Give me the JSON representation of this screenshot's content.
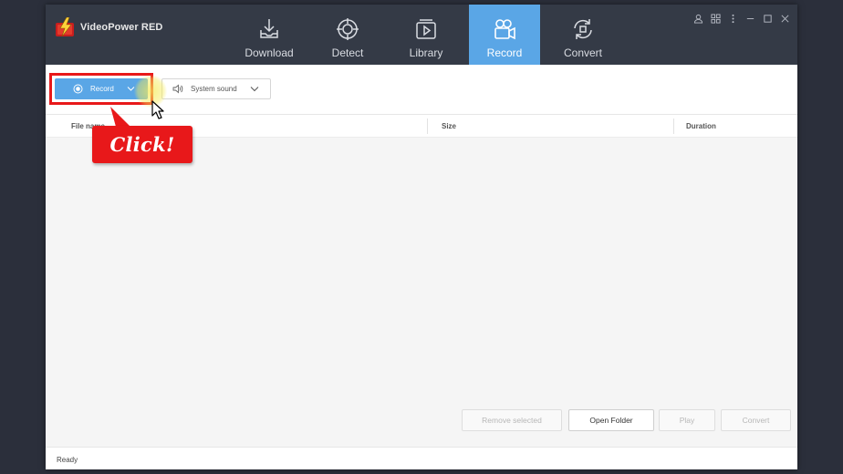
{
  "app": {
    "title": "VideoPower RED"
  },
  "tabs": [
    {
      "label": "Download",
      "icon": "download-icon"
    },
    {
      "label": "Detect",
      "icon": "detect-icon"
    },
    {
      "label": "Library",
      "icon": "library-icon"
    },
    {
      "label": "Record",
      "icon": "record-camera-icon",
      "active": true
    },
    {
      "label": "Convert",
      "icon": "convert-icon"
    }
  ],
  "window_controls": [
    "user-icon",
    "grid-icon",
    "more-icon",
    "minimize-icon",
    "maximize-icon",
    "close-icon"
  ],
  "toolbar": {
    "record_label": "Record",
    "sound_label": "System sound"
  },
  "table": {
    "columns": [
      "File name",
      "Size",
      "Duration"
    ],
    "rows": []
  },
  "actions": {
    "remove_selected": "Remove selected",
    "open_folder": "Open Folder",
    "play": "Play",
    "convert": "Convert"
  },
  "status": {
    "text": "Ready"
  },
  "annotation": {
    "callout_text": "Click!"
  },
  "colors": {
    "titlebar": "#343a46",
    "accent": "#5aa6e6",
    "highlight": "#e8181a",
    "background": "#2b2f3b"
  }
}
